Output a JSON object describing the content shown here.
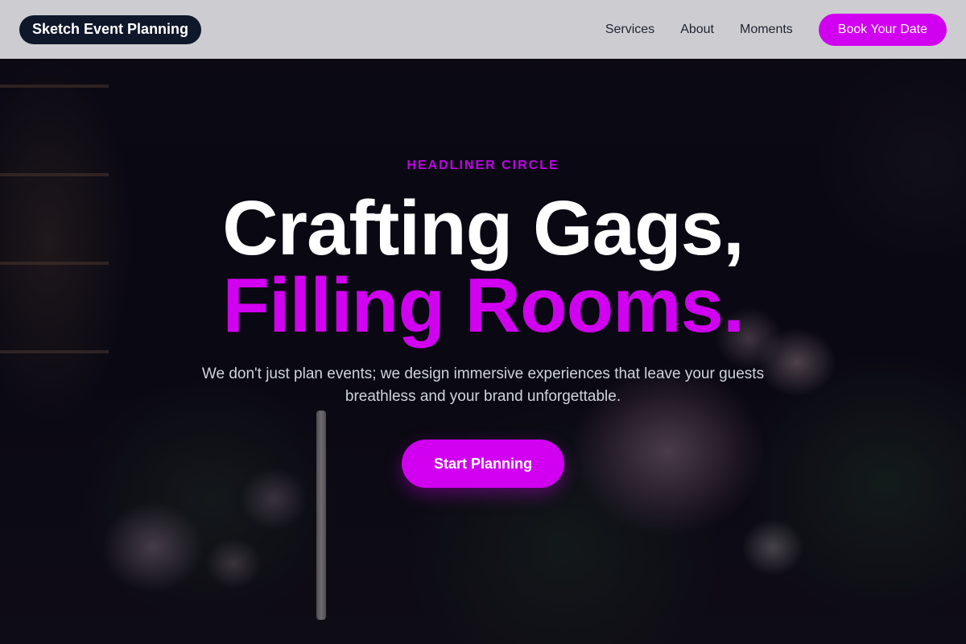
{
  "header": {
    "brand": "Sketch Event Planning",
    "nav": [
      {
        "label": "Services"
      },
      {
        "label": "About"
      },
      {
        "label": "Moments"
      }
    ],
    "cta_label": "Book Your Date"
  },
  "hero": {
    "eyebrow": "HEADLINER CIRCLE",
    "title_line1": "Crafting Gags,",
    "title_line2": "Filling Rooms.",
    "subtitle": "We don't just plan events; we design immersive experiences that leave your guests breathless and your brand unforgettable.",
    "button_label": "Start Planning"
  },
  "colors": {
    "accent": "#d100f0",
    "brand_bg": "#0f172a",
    "header_bg": "#dedee2"
  }
}
